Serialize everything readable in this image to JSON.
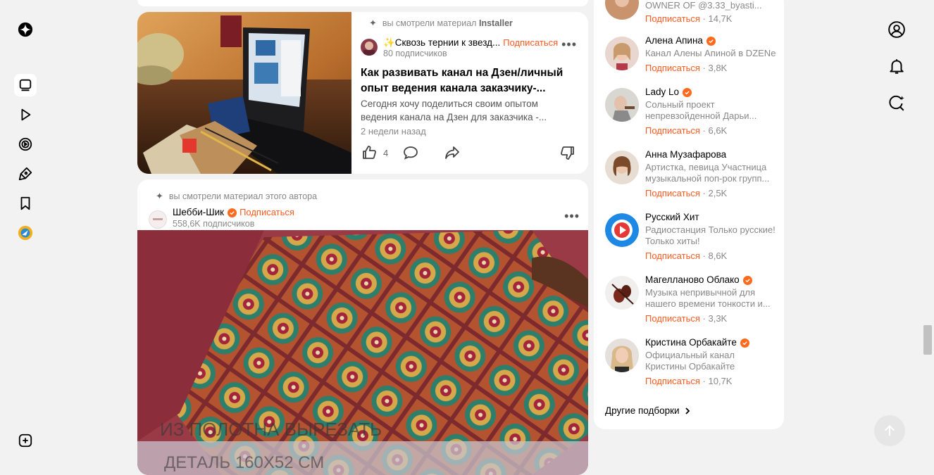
{
  "left_nav": {
    "items": [
      {
        "name": "zen-logo-icon"
      },
      {
        "name": "feed-icon",
        "active": true
      },
      {
        "name": "video-icon"
      },
      {
        "name": "shorts-icon"
      },
      {
        "name": "studio-icon"
      },
      {
        "name": "bookmark-icon"
      },
      {
        "name": "channel-avatar-icon"
      }
    ],
    "bottom": {
      "name": "add-icon"
    }
  },
  "right_nav": {
    "items": [
      {
        "name": "profile-icon"
      },
      {
        "name": "notifications-icon"
      },
      {
        "name": "search-sparkle-icon"
      }
    ]
  },
  "feed": {
    "card1": {
      "seen_prefix": "вы смотрели материал",
      "seen_source": "Installer",
      "channel_name": "✨Сквозь тернии к звезд...",
      "subscribe": "Подписаться",
      "subscribers": "80 подписчиков",
      "title": "Как развивать канал на Дзен/личный опыт ведения канала заказчику-...",
      "title_l1": "Как развивать канал на Дзен/личный",
      "title_l2": "опыт ведения канала заказчику-...",
      "snippet_l1": "Сегодня хочу поделиться своим опытом",
      "snippet_l2": "ведения канала на Дзен для заказчика -...",
      "time": "2 недели назад",
      "likes": "4"
    },
    "card2": {
      "seen_text": "вы смотрели материал этого автора",
      "channel_name": "Шебби-Шик",
      "subscribe": "Подписаться",
      "subscribers": "558,6K подписчиков",
      "overlay_text_1": "ИЗ ПОЛОТНА ВЫРЕЗАТЬ",
      "overlay_text_2": "ДЕТАЛЬ 160Х52 СМ"
    }
  },
  "channels": {
    "items": [
      {
        "name": "",
        "verified": false,
        "desc1": "OWNER OF @3.33_byasti...",
        "desc2": "",
        "subscribe": "Подписаться",
        "count": "14,7K"
      },
      {
        "name": "Алена Апина",
        "verified": true,
        "desc1": "Канал Алены Апиной в DZENe",
        "desc2": "",
        "subscribe": "Подписаться",
        "count": "3,8K"
      },
      {
        "name": "Lady Lo",
        "verified": true,
        "desc1": "Сольный проект",
        "desc2": "непревзойденной Дарьи...",
        "subscribe": "Подписаться",
        "count": "6,6K"
      },
      {
        "name": "Анна Музафарова",
        "verified": false,
        "desc1": "Артистка, певица Участница",
        "desc2": "музыкальной поп-рок групп...",
        "subscribe": "Подписаться",
        "count": "2,5K"
      },
      {
        "name": "Русский Хит",
        "verified": false,
        "desc1": "Радиостанция Только русские!",
        "desc2": "Только хиты!",
        "subscribe": "Подписаться",
        "count": "8,6K"
      },
      {
        "name": "Магелланово Облако",
        "verified": true,
        "desc1": "Музыка непривычной для",
        "desc2": "нашего времени тонкости и...",
        "subscribe": "Подписаться",
        "count": "3,3K"
      },
      {
        "name": "Кристина Орбакайте",
        "verified": true,
        "desc1": "Официальный канал",
        "desc2": "Кристины Орбакайте",
        "subscribe": "Подписаться",
        "count": "10,7K"
      }
    ],
    "more": "Другие подборки",
    "sep": "·"
  },
  "colors": {
    "accent": "#ff5a1f",
    "verified": "#ff6a1c"
  }
}
